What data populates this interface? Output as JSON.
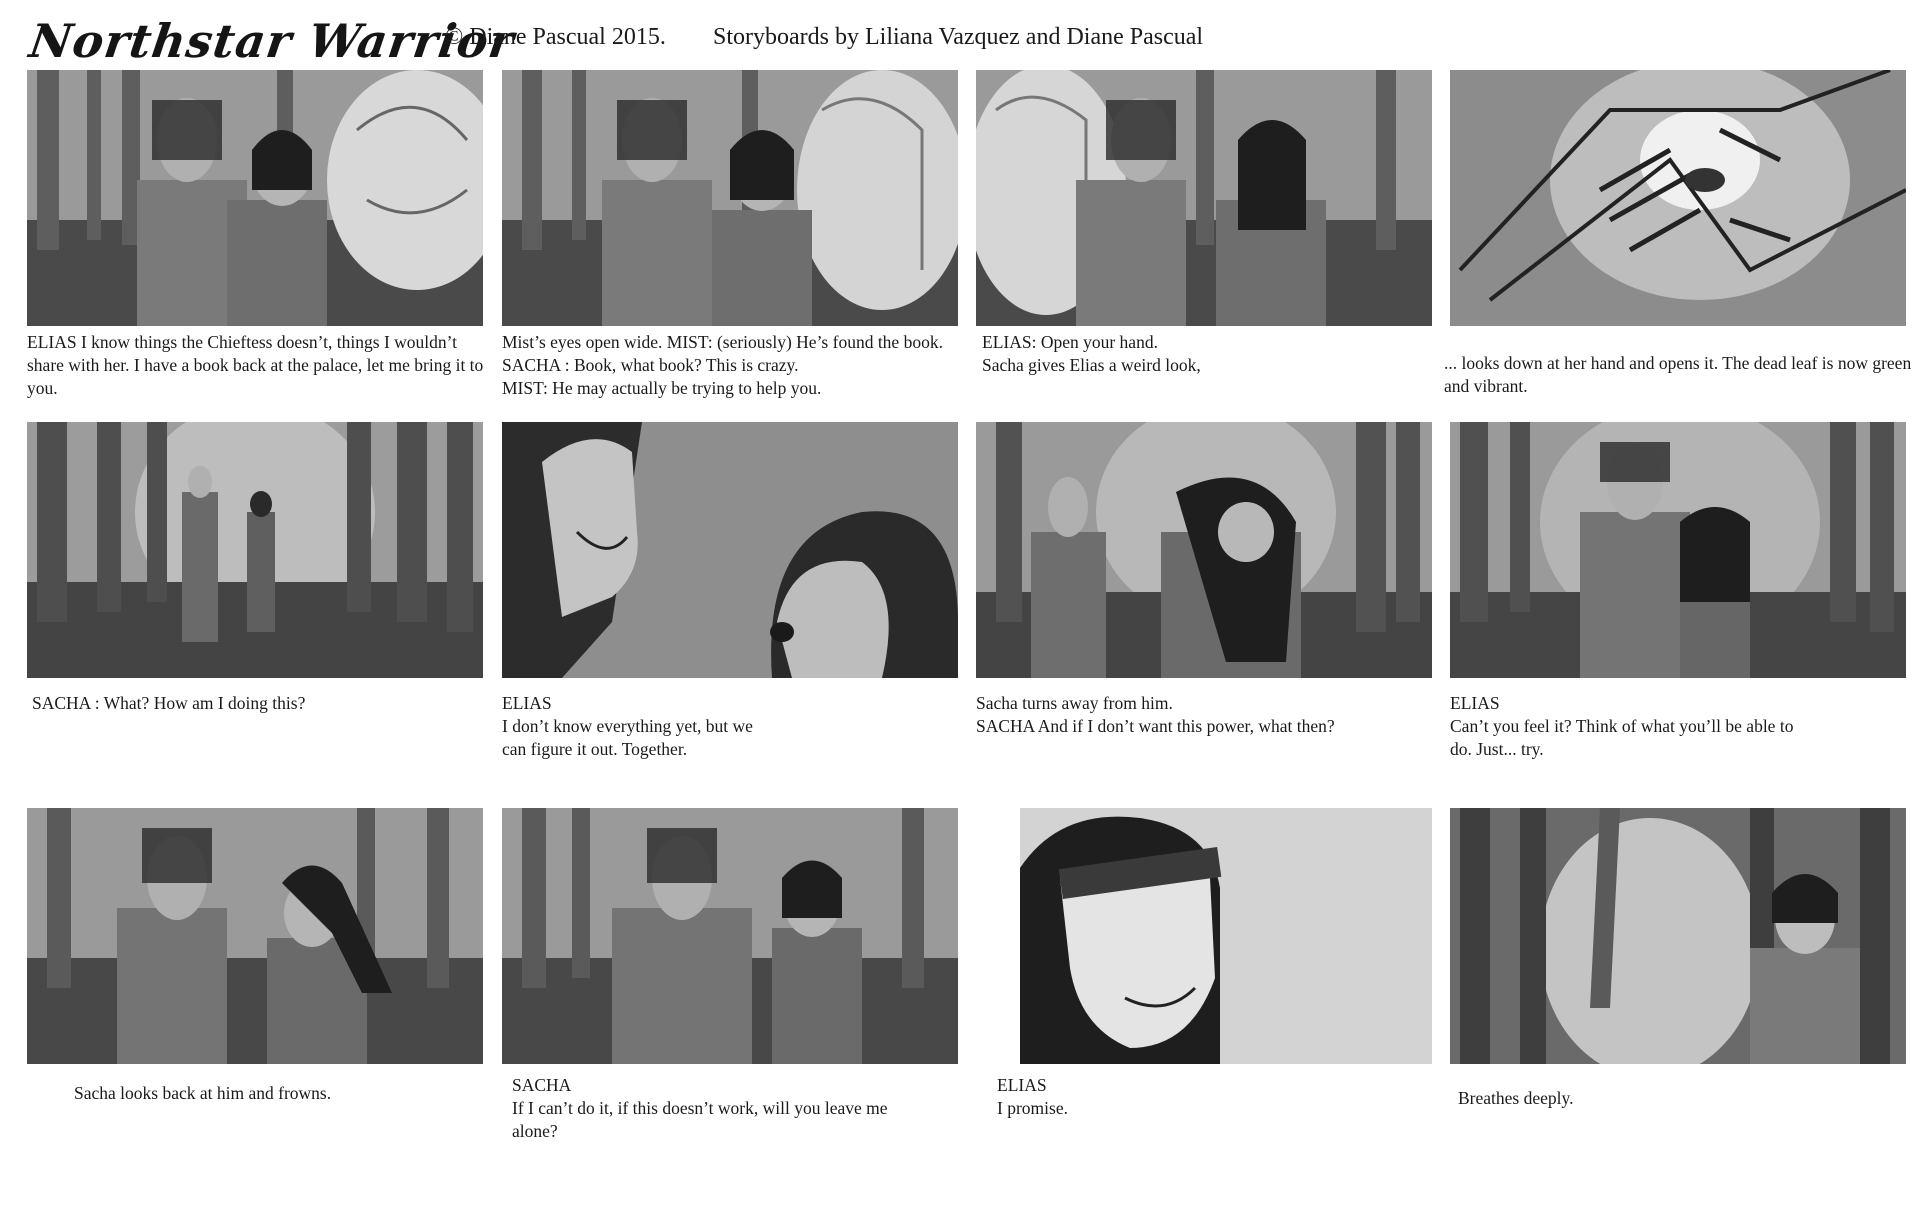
{
  "header": {
    "title": "Northstar Warrior",
    "copyright": "© Diane Pascual 2015.",
    "credits": "Storyboards by Liliana Vazquez and Diane Pascual"
  },
  "panels": [
    {
      "caption": "ELIAS I know things the Chieftess doesn’t, things I wouldn’t share with her. I have a book back at the palace, let me bring it to you."
    },
    {
      "caption": "Mist’s eyes open wide. MIST: (seriously) He’s found the book.\nSACHA : Book, what book? This is crazy.\nMIST: He may actually be trying to help you."
    },
    {
      "caption": "ELIAS:  Open your hand.\nSacha gives Elias a weird look,"
    },
    {
      "caption": "... looks down at her hand and opens it. The dead leaf is now green and vibrant."
    },
    {
      "caption": "SACHA : What? How am I doing this?"
    },
    {
      "caption": "ELIAS\nI don’t know everything yet, but we\ncan figure it out. Together."
    },
    {
      "caption": "Sacha turns away from him.\nSACHA And if I don’t want this power, what then?"
    },
    {
      "caption": "ELIAS\nCan’t you feel it? Think of what you’ll be able to\ndo. Just... try."
    },
    {
      "caption": "Sacha looks back at him and frowns."
    },
    {
      "caption": "SACHA\nIf I can’t do it, if this doesn’t work, will you leave me\nalone?"
    },
    {
      "caption": "ELIAS\nI promise."
    },
    {
      "caption": "Breathes deeply."
    }
  ]
}
